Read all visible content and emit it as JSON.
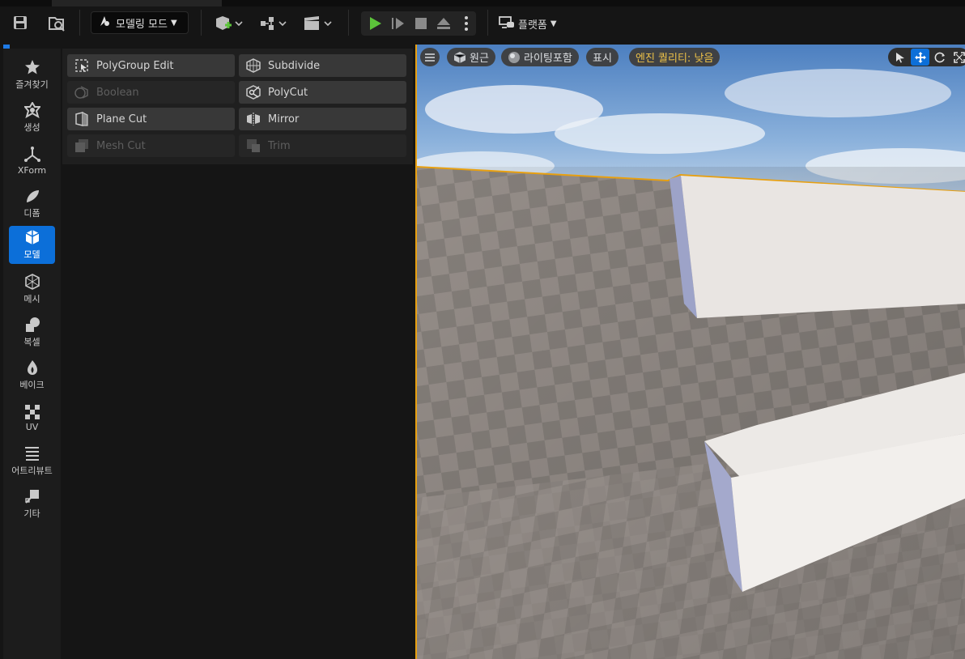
{
  "toolbar": {
    "mode_label": "모델링 모드",
    "platform_label": "플랫폼"
  },
  "sidebar": {
    "items": [
      {
        "label": "즐겨찾기",
        "icon": "star-icon"
      },
      {
        "label": "생성",
        "icon": "create-icon"
      },
      {
        "label": "XForm",
        "icon": "xform-icon"
      },
      {
        "label": "디폼",
        "icon": "deform-icon"
      },
      {
        "label": "모델",
        "icon": "model-icon",
        "active": true
      },
      {
        "label": "메시",
        "icon": "mesh-icon"
      },
      {
        "label": "복셀",
        "icon": "voxel-icon"
      },
      {
        "label": "베이크",
        "icon": "bake-icon"
      },
      {
        "label": "UV",
        "icon": "uv-icon"
      },
      {
        "label": "어트리뷰트",
        "icon": "attribute-icon"
      },
      {
        "label": "기타",
        "icon": "misc-icon"
      }
    ]
  },
  "tools": [
    {
      "label": "PolyGroup Edit",
      "enabled": true
    },
    {
      "label": "Subdivide",
      "enabled": true
    },
    {
      "label": "Boolean",
      "enabled": false
    },
    {
      "label": "PolyCut",
      "enabled": true
    },
    {
      "label": "Plane Cut",
      "enabled": true
    },
    {
      "label": "Mirror",
      "enabled": true
    },
    {
      "label": "Mesh Cut",
      "enabled": false
    },
    {
      "label": "Trim",
      "enabled": false
    }
  ],
  "viewport": {
    "perspective_label": "원근",
    "lighting_label": "라이팅포함",
    "show_label": "표시",
    "quality_label": "엔진 퀄리티: 낮음"
  },
  "colors": {
    "accent": "#0c6fd9",
    "selection_outline": "#e8a010",
    "play_green": "#5cc43a",
    "quality_text": "#f5c542"
  }
}
